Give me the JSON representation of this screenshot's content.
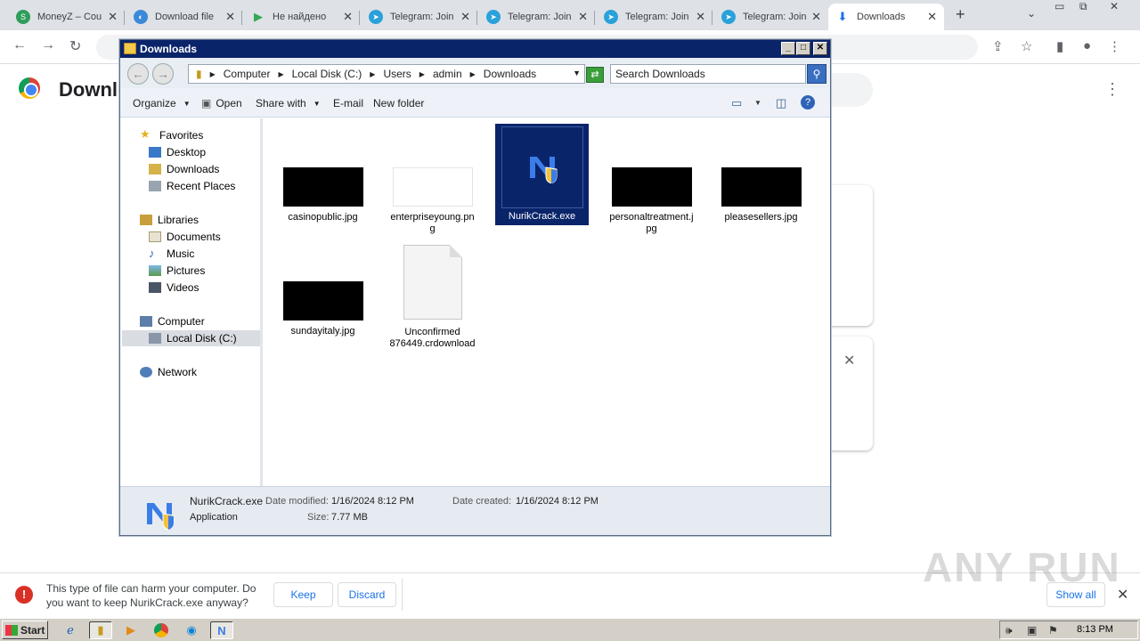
{
  "browser": {
    "tabs": [
      {
        "label": "MoneyZ – Cou",
        "icon": "moneyz-icon",
        "color": "#2e9e5a",
        "glyph": "S"
      },
      {
        "label": "Download file",
        "icon": "download-site-icon",
        "color": "#3b8ad9",
        "glyph": "◐"
      },
      {
        "label": "Не найдено",
        "icon": "play-store-icon",
        "color": "#34a853",
        "glyph": "▶"
      },
      {
        "label": "Telegram: Join",
        "icon": "telegram-icon",
        "color": "#2aa1da",
        "glyph": "➤"
      },
      {
        "label": "Telegram: Join",
        "icon": "telegram-icon",
        "color": "#2aa1da",
        "glyph": "➤"
      },
      {
        "label": "Telegram: Join",
        "icon": "telegram-icon",
        "color": "#2aa1da",
        "glyph": "➤"
      },
      {
        "label": "Telegram: Join",
        "icon": "telegram-icon",
        "color": "#2aa1da",
        "glyph": "➤"
      },
      {
        "label": "Downloads",
        "icon": "download-icon",
        "color": "#1a73e8",
        "glyph": "⬇"
      }
    ],
    "page_title": "Downle"
  },
  "explorer": {
    "title": "Downloads",
    "breadcrumb": [
      "Computer",
      "Local Disk (C:)",
      "Users",
      "admin",
      "Downloads"
    ],
    "search_placeholder": "Search Downloads",
    "commands": {
      "organize": "Organize",
      "open": "Open",
      "share_with": "Share with",
      "email": "E-mail",
      "new_folder": "New folder"
    },
    "nav": {
      "favorites": "Favorites",
      "desktop": "Desktop",
      "downloads": "Downloads",
      "recent_places": "Recent Places",
      "libraries": "Libraries",
      "documents": "Documents",
      "music": "Music",
      "pictures": "Pictures",
      "videos": "Videos",
      "computer": "Computer",
      "local_disk": "Local Disk (C:)",
      "network": "Network"
    },
    "files": [
      {
        "name": "casinopublic.jpg",
        "thumb": "#000000"
      },
      {
        "name": "enterpriseyoung.png",
        "thumb": "#ffffff"
      },
      {
        "name": "NurikCrack.exe",
        "thumb": "#0a246a"
      },
      {
        "name": "personaltreatment.jpg",
        "thumb": "#000000"
      },
      {
        "name": "pleasesellers.jpg",
        "thumb": "#000000"
      },
      {
        "name": "sundayitaly.jpg",
        "thumb": "#000000"
      },
      {
        "name": "Unconfirmed 876449.crdownload",
        "thumb": "#f4f4f4"
      }
    ],
    "details": {
      "name": "NurikCrack.exe",
      "type": "Application",
      "date_modified_label": "Date modified:",
      "date_modified": "1/16/2024 8:12 PM",
      "date_created_label": "Date created:",
      "date_created": "1/16/2024 8:12 PM",
      "size_label": "Size:",
      "size": "7.77 MB"
    }
  },
  "warning": {
    "text": "This type of file can harm your computer. Do you want to keep NurikCrack.exe anyway?",
    "keep": "Keep",
    "discard": "Discard",
    "show_all": "Show all"
  },
  "watermark": "ANY RUN",
  "taskbar": {
    "start": "Start",
    "clock": "8:13 PM"
  }
}
